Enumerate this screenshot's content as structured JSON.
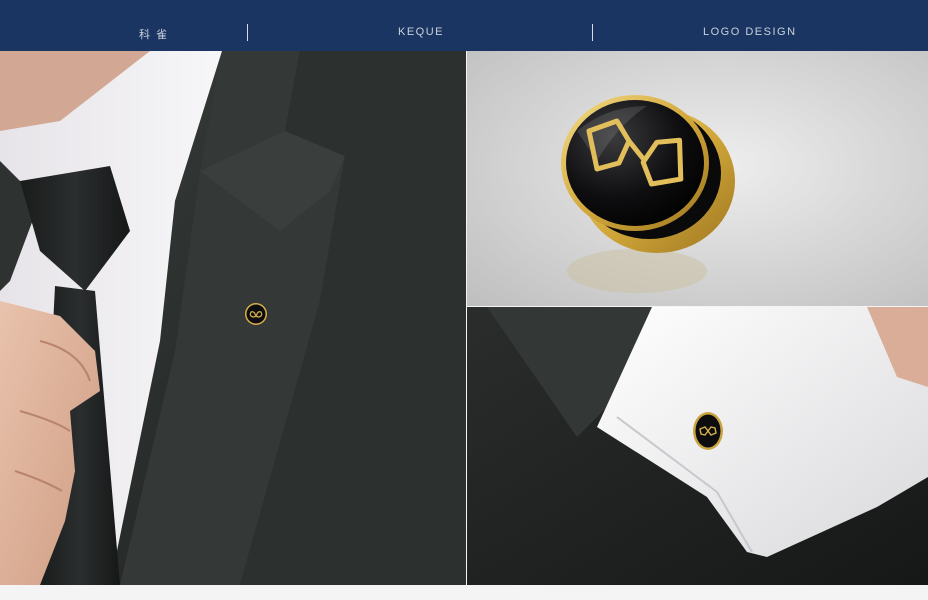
{
  "header": {
    "brand_cn": "科 雀",
    "brand_en": "KEQUE",
    "section": "LOGO DESIGN"
  },
  "colors": {
    "header_bg": "#1b3563",
    "suit": "#2a2e2c",
    "shirt": "#f2f0f3",
    "gold": "#d6b04a",
    "enamel": "#0d0d0f"
  },
  "images": {
    "left": "suit-lapel-pin-photo",
    "top_right": "gold-enamel-pin-closeup",
    "bottom_right": "shirt-cuff-button-photo"
  }
}
